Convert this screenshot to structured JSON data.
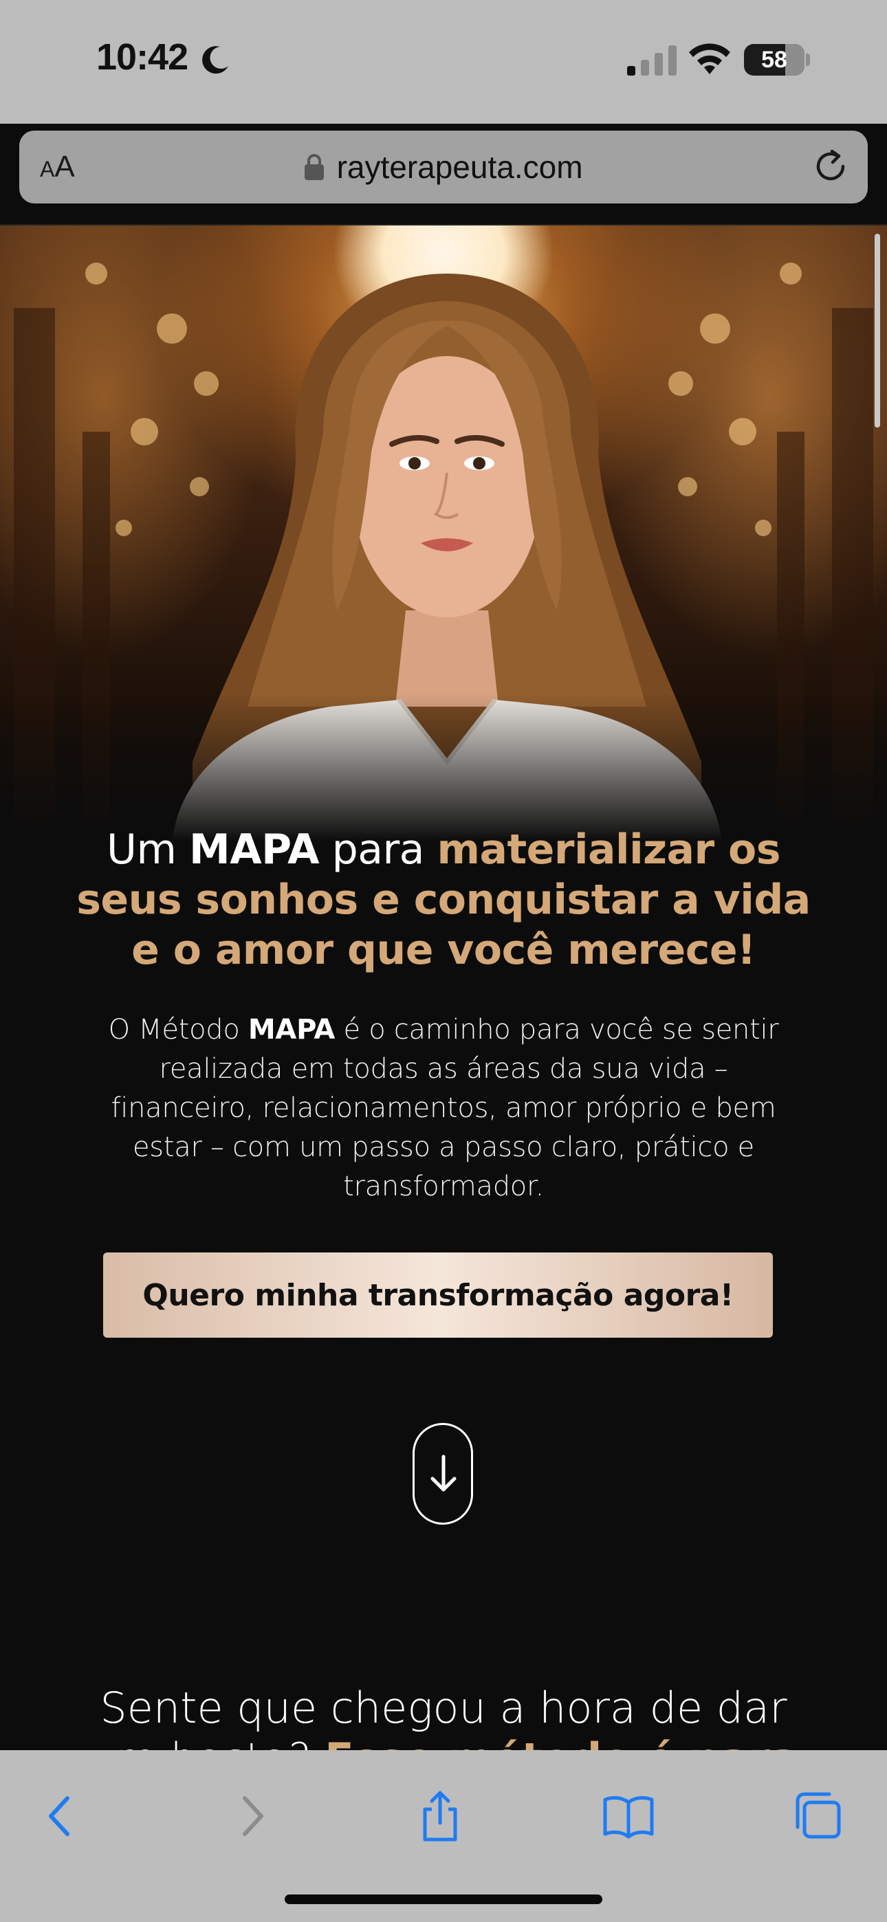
{
  "status_bar": {
    "time": "10:42",
    "battery": "58",
    "icons": [
      "moon-icon",
      "signal-icon",
      "wifi-icon",
      "battery-icon"
    ]
  },
  "address_bar": {
    "text_size_label_small": "A",
    "text_size_label_large": "A",
    "url": "rayterapeuta.com",
    "icons": [
      "lock-icon",
      "reload-icon"
    ]
  },
  "hero": {
    "headline": {
      "part1": "Um ",
      "part2": "MAPA",
      "part3": " para ",
      "part4": "materializar os seus sonhos e conquistar a vida e o amor que você merece!"
    },
    "description": {
      "part1": "O Método ",
      "part2": "MAPA",
      "part3": " é o caminho para você se sentir realizada em todas as áreas da sua vida – financeiro, relacionamentos, amor próprio e bem estar – com um passo a passo claro, prático e transformador."
    },
    "cta_label": "Quero minha transformação agora!"
  },
  "next_section": {
    "heading_part1": "Sente que chegou a hora de dar um basta? ",
    "heading_part2": "Esse método é para"
  },
  "toolbar": {
    "icons": [
      "back-icon",
      "forward-icon",
      "share-icon",
      "bookmarks-icon",
      "tabs-icon"
    ]
  },
  "colors": {
    "accent_gold": "#d5a878",
    "background": "#0c0c0c",
    "cta_light": "#f5e6da",
    "ios_blue": "#1f7cf2"
  }
}
